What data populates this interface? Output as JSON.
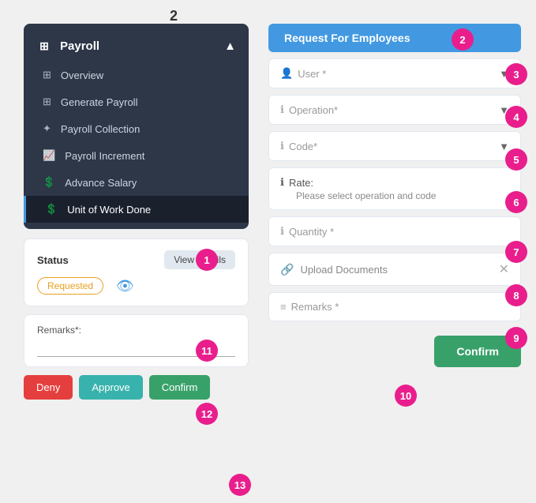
{
  "header": {
    "step_number": "2"
  },
  "sidebar": {
    "title": "Payroll",
    "items": [
      {
        "label": "Overview",
        "icon": "⊞",
        "active": false
      },
      {
        "label": "Generate Payroll",
        "icon": "⊞",
        "active": false
      },
      {
        "label": "Payroll Collection",
        "icon": "✦",
        "active": false
      },
      {
        "label": "Payroll Increment",
        "icon": "📈",
        "active": false
      },
      {
        "label": "Advance Salary",
        "icon": "💲",
        "active": false
      },
      {
        "label": "Unit of Work Done",
        "icon": "💲",
        "active": true
      }
    ]
  },
  "status_card": {
    "status_label": "Status",
    "view_details_label": "View Details",
    "requested_label": "Requested"
  },
  "remarks_section": {
    "label": "Remarks*:",
    "placeholder": ""
  },
  "action_buttons": {
    "deny_label": "Deny",
    "approve_label": "Approve",
    "confirm_label": "Confirm"
  },
  "right_panel": {
    "request_btn_label": "Request For Employees",
    "user_label": "User *",
    "operation_label": "Operation*",
    "code_label": "Code*",
    "rate_label": "Rate:",
    "rate_hint": "Please select operation and code",
    "quantity_label": "Quantity *",
    "upload_label": "Upload Documents",
    "remarks_label": "Remarks *",
    "confirm_btn_label": "Confirm"
  },
  "step_badges": {
    "badge_1": "1",
    "badge_2_left": "2",
    "badge_2_right": "2",
    "badge_3": "3",
    "badge_4": "4",
    "badge_5": "5",
    "badge_6": "6",
    "badge_7": "7",
    "badge_8": "8",
    "badge_9": "9",
    "badge_10": "10",
    "badge_11": "11",
    "badge_12": "12",
    "badge_13": "13"
  }
}
